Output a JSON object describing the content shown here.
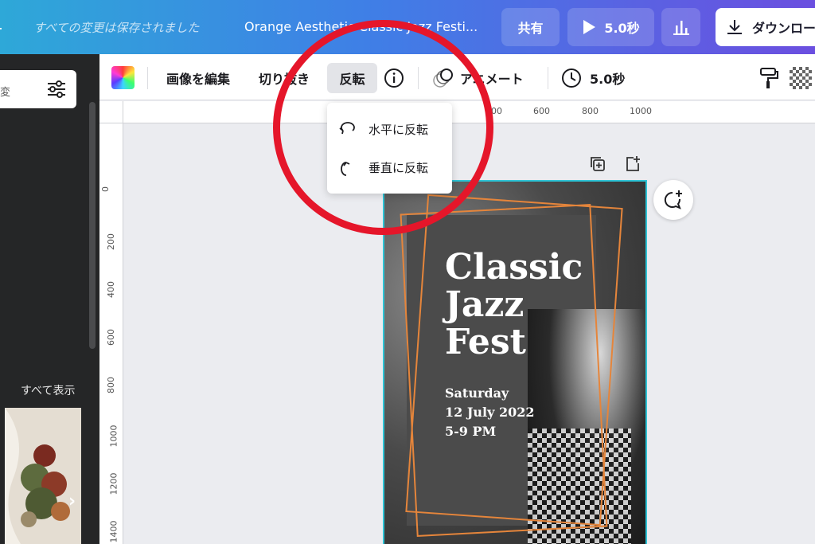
{
  "topbar": {
    "autosave_status": "すべての変更は保存されました",
    "document_title": "Orange Aesthetic Classic Jazz Festi...",
    "share_label": "共有",
    "play_label": "5.0秒",
    "download_label": "ダウンロー"
  },
  "left_panel": {
    "search_fragment": "変",
    "see_all_label": "すべて表示",
    "collapse_glyph": "‹",
    "next_glyph": "›"
  },
  "toolbar": {
    "edit_image_label": "画像を編集",
    "crop_label": "切り抜き",
    "flip_label": "反転",
    "animate_label": "アニメート",
    "duration_label": "5.0秒"
  },
  "flip_menu": {
    "horizontal_label": "水平に反転",
    "vertical_label": "垂直に反転"
  },
  "ruler": {
    "top_ticks": [
      "400",
      "600",
      "800",
      "1000"
    ],
    "left_ticks": [
      "0",
      "200",
      "400",
      "600",
      "800",
      "1000",
      "1200",
      "1400"
    ]
  },
  "poster": {
    "title_line1": "Classic",
    "title_line2": "Jazz",
    "title_line3": "Fest",
    "day": "Saturday",
    "date": "12 July 2022",
    "time": "5-9 PM"
  },
  "colors": {
    "accent_gradient_start": "#2ea8d8",
    "accent_gradient_end": "#6b4fe0",
    "annotation_red": "#e5162a",
    "frame_orange": "#e5853b",
    "selection_teal": "#2ec4d6"
  },
  "icons": {
    "play": "play-icon",
    "stats": "bar-chart-icon",
    "download": "download-icon",
    "filter": "sliders-icon",
    "info": "info-icon",
    "animate": "animate-icon",
    "clock": "clock-icon",
    "paint": "paint-roller-icon",
    "transparency": "transparency-icon",
    "flip_horizontal": "flip-horizontal-icon",
    "flip_vertical": "flip-vertical-icon",
    "duplicate_page": "duplicate-page-icon",
    "add_page": "add-page-icon",
    "comment": "comment-add-icon"
  }
}
